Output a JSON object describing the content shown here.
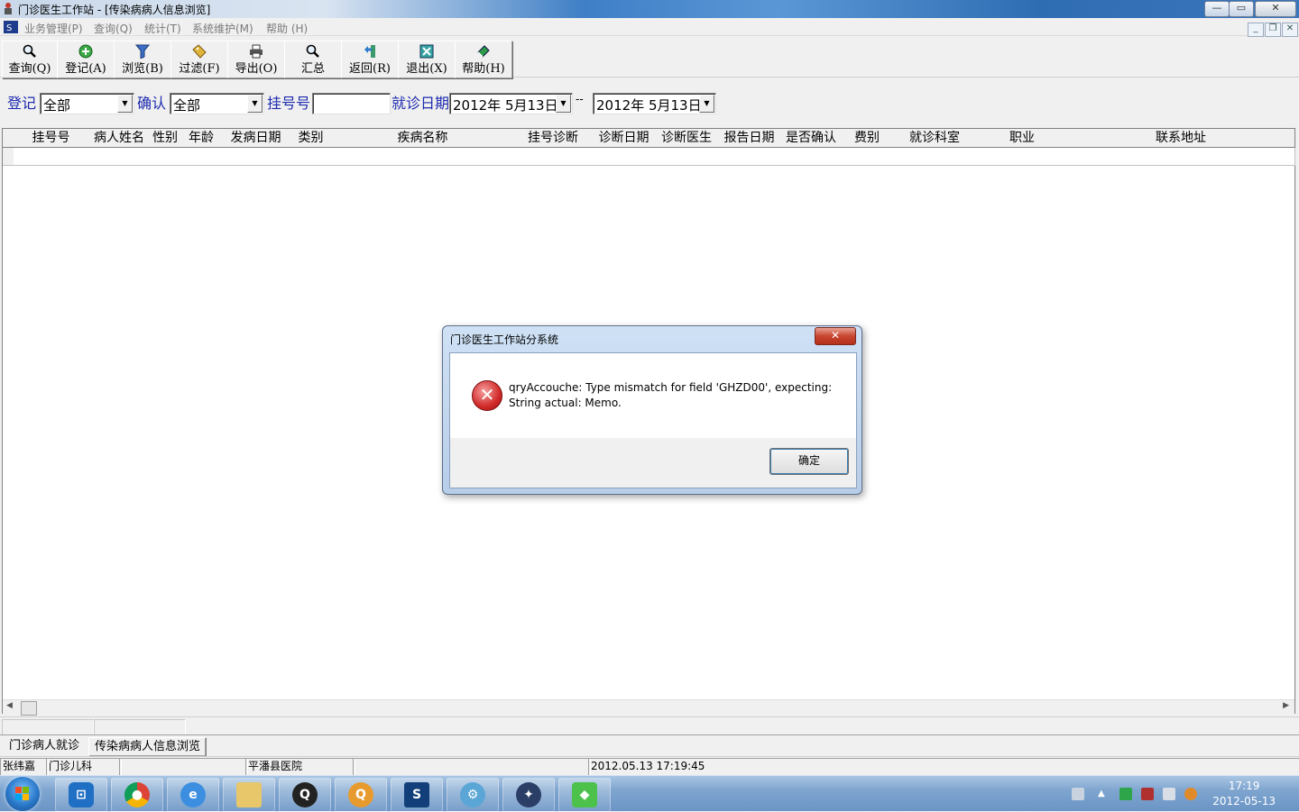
{
  "window": {
    "title": "门诊医生工作站 - [传染病病人信息浏览]",
    "controls": [
      "—",
      "▭",
      "✕"
    ],
    "mdi_controls": [
      "_",
      "❐",
      "✕"
    ]
  },
  "menu": [
    {
      "label": "业务管理(P)"
    },
    {
      "label": "查询(Q)"
    },
    {
      "label": "统计(T)"
    },
    {
      "label": "系统维护(M)"
    },
    {
      "label": "帮助 (H)"
    }
  ],
  "toolbar": [
    {
      "label": "查询(Q)",
      "icon": "magnifier-icon"
    },
    {
      "label": "登记(A)",
      "icon": "add-circle-icon"
    },
    {
      "label": "浏览(B)",
      "icon": "funnel-icon"
    },
    {
      "label": "过滤(F)",
      "icon": "tag-icon"
    },
    {
      "label": "导出(O)",
      "icon": "printer-icon"
    },
    {
      "label": "汇总",
      "icon": "magnifier-icon"
    },
    {
      "label": "返回(R)",
      "icon": "return-arrow-icon"
    },
    {
      "label": "退出(X)",
      "icon": "exit-icon"
    },
    {
      "label": "帮助(H)",
      "icon": "help-book-icon"
    }
  ],
  "filters": {
    "register_label": "登记",
    "register_value": "全部",
    "confirm_label": "确认",
    "confirm_value": "全部",
    "regno_label": "挂号号",
    "regno_value": "",
    "date_label": "就诊日期",
    "date_from": "2012年  5月13日",
    "date_sep": "--",
    "date_to": "2012年  5月13日"
  },
  "grid": {
    "columns": [
      "挂号号",
      "病人姓名",
      "性别",
      "年龄",
      "发病日期",
      "类别",
      "疾病名称",
      "挂号诊断",
      "诊断日期",
      "诊断医生",
      "报告日期",
      "是否确认",
      "费别",
      "就诊科室",
      "职业",
      "联系地址"
    ]
  },
  "tabs": [
    {
      "label": "门诊病人就诊",
      "active": false
    },
    {
      "label": "传染病病人信息浏览",
      "active": true
    }
  ],
  "status": {
    "user": "张纬嘉",
    "dept": "门诊儿科",
    "blank": "",
    "hospital": "平潘县医院",
    "blank2": "",
    "datetime": "2012.05.13 17:19:45"
  },
  "dialog": {
    "title": "门诊医生工作站分系统",
    "close": "✕",
    "icon": "error-icon",
    "icon_glyph": "✕",
    "message_line1": "qryAccouche: Type mismatch for field 'GHZD00', expecting:",
    "message_line2": "String actual: Memo.",
    "ok_label": "确定"
  },
  "taskbar": {
    "apps": [
      "windows-explorer-icon",
      "chrome-icon",
      "internet-explorer-icon",
      "folder-icon",
      "qq-icon",
      "qq-game-icon",
      "sql-tool-icon",
      "network-tool-icon",
      "compass-icon",
      "green-app-icon"
    ],
    "clock_time": "17:19",
    "clock_date": "2012-05-13"
  },
  "colors": {
    "label_blue": "#1d2bb0",
    "error_red": "#d12a2a",
    "title_blue": "#3f7fc6"
  }
}
